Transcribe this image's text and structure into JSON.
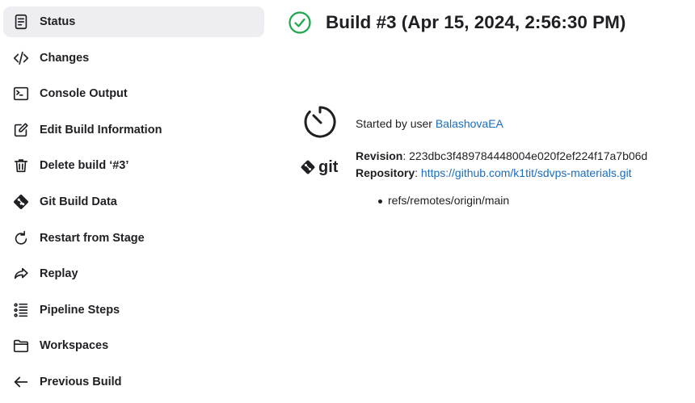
{
  "sidebar": {
    "items": [
      {
        "label": "Status",
        "icon": "document-icon",
        "active": true
      },
      {
        "label": "Changes",
        "icon": "code-icon"
      },
      {
        "label": "Console Output",
        "icon": "terminal-icon"
      },
      {
        "label": "Edit Build Information",
        "icon": "edit-icon"
      },
      {
        "label": "Delete build ‘#3’",
        "icon": "trash-icon"
      },
      {
        "label": "Git Build Data",
        "icon": "git-icon"
      },
      {
        "label": "Restart from Stage",
        "icon": "restart-icon"
      },
      {
        "label": "Replay",
        "icon": "replay-icon"
      },
      {
        "label": "Pipeline Steps",
        "icon": "list-icon"
      },
      {
        "label": "Workspaces",
        "icon": "folder-icon"
      },
      {
        "label": "Previous Build",
        "icon": "arrow-left-icon"
      }
    ]
  },
  "build": {
    "title": "Build #3 (Apr 15, 2024, 2:56:30 PM)",
    "status_color": "#1ea64b",
    "started_prefix": "Started by user ",
    "started_user": "BalashovaEA",
    "revision_label": "Revision",
    "revision_value": ": 223dbc3f489784448004e020f2ef224f17a7b06d",
    "repository_label": "Repository",
    "repository_sep": ": ",
    "repository_url": "https://github.com/k1tit/sdvps-materials.git",
    "branches": [
      "refs/remotes/origin/main"
    ],
    "git_logo_text": "git"
  },
  "colors": {
    "link": "#1a6ebd",
    "active_bg": "#eeeef2",
    "success": "#1ea64b"
  }
}
